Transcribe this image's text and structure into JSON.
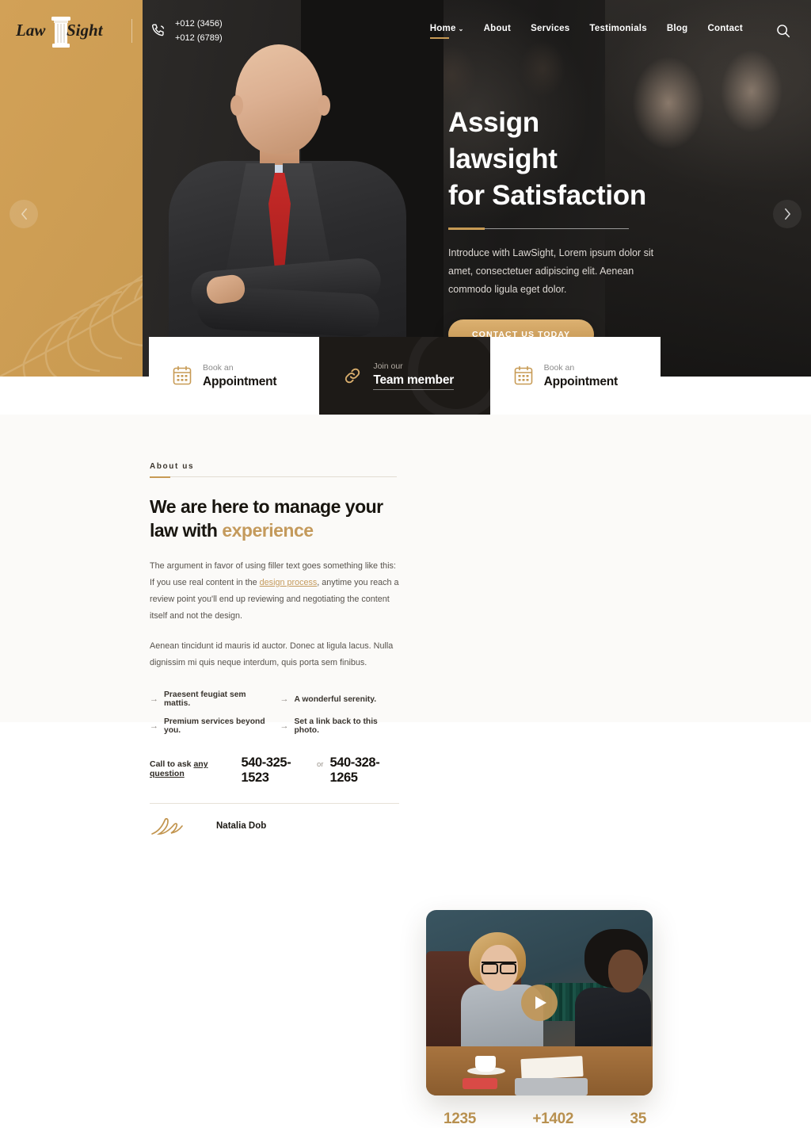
{
  "header": {
    "logo": {
      "word1": "Law",
      "word2": "Sight",
      "icon": "pillar-icon"
    },
    "phones": {
      "icon": "phone-icon",
      "line1": "+012 (3456)",
      "line2": "+012 (6789)"
    },
    "nav": [
      {
        "label": "Home",
        "active": true,
        "caret": "⌄"
      },
      {
        "label": "About",
        "active": false
      },
      {
        "label": "Services",
        "active": false
      },
      {
        "label": "Testimonials",
        "active": false
      },
      {
        "label": "Blog",
        "active": false
      },
      {
        "label": "Contact",
        "active": false
      }
    ],
    "search_icon": "search-icon"
  },
  "hero": {
    "title_line1": "Assign",
    "title_line2": "lawsight",
    "title_line3": "for Satisfaction",
    "paragraph": "Introduce with LawSight, Lorem ipsum dolor sit amet, consectetuer adipiscing elit. Aenean commodo ligula eget dolor.",
    "cta": "CONTACT US TODAY",
    "prev_arrow": "chevron-left-icon",
    "next_arrow": "chevron-right-icon"
  },
  "cards": [
    {
      "sub": "Book an",
      "title": "Appointment",
      "icon": "calendar-icon",
      "theme": "light"
    },
    {
      "sub": "Join our",
      "title": "Team member",
      "icon": "link-icon",
      "theme": "dark"
    },
    {
      "sub": "Book an",
      "title": "Appointment",
      "icon": "calendar-icon",
      "theme": "light"
    }
  ],
  "about": {
    "eyebrow": "About us",
    "heading_plain": "We are here to manage your law with ",
    "heading_gold": "experience",
    "paragraph1_before": "The argument in favor of using filler text goes something like this: If you use real content in the ",
    "paragraph1_link": "design process",
    "paragraph1_after": ", anytime you reach a review point you'll end up reviewing and negotiating the content itself and not the design.",
    "paragraph2": "Aenean tincidunt id mauris id auctor. Donec at ligula lacus. Nulla dignissim mi quis neque interdum, quis porta sem finibus.",
    "bullets": [
      "Praesent feugiat sem mattis.",
      "A wonderful serenity.",
      "Premium services beyond you.",
      "Set a link back to this photo."
    ],
    "bullet_marker": "→",
    "cta_label_before": "Call to ask ",
    "cta_label_link": "any question",
    "cta_phone1": "540-325-1523",
    "cta_or": "or",
    "cta_phone2": "540-328-1265",
    "signature_name": "Natalia Dob",
    "signature_icon": "signature-icon"
  },
  "video": {
    "play_icon": "play-icon"
  },
  "stats": [
    {
      "value": "1235"
    },
    {
      "value": "+1402"
    },
    {
      "value": "35"
    }
  ],
  "colors": {
    "gold": "#c79a54",
    "gold_light": "#dcb171",
    "dark": "#1d1a17"
  }
}
